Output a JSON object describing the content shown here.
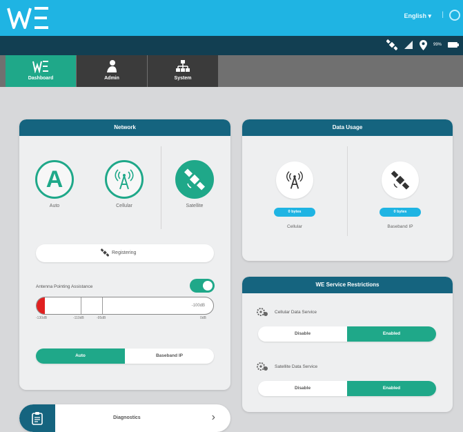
{
  "header": {
    "language": "English",
    "language_caret": "▾",
    "separator": "|"
  },
  "status": {
    "icons": [
      "satellite-icon",
      "signal-icon",
      "location-icon",
      "battery-icon"
    ],
    "battery_percent": "99%"
  },
  "nav": {
    "tabs": [
      {
        "label": "Dashboard",
        "icon": "we-logo-icon",
        "active": true
      },
      {
        "label": "Admin",
        "icon": "user-icon",
        "active": false
      },
      {
        "label": "System",
        "icon": "network-tree-icon",
        "active": false
      }
    ]
  },
  "network": {
    "title": "Network",
    "modes": [
      {
        "label": "Auto",
        "icon": "letter-a-icon",
        "glyph": "A"
      },
      {
        "label": "Cellular",
        "icon": "cell-tower-icon"
      },
      {
        "label": "Satellite",
        "icon": "satellite-icon",
        "selected": true
      }
    ],
    "registration_status": "Registering",
    "antenna_label": "Antenna Pointing Assistance",
    "antenna_enabled": true,
    "signal_value": "-100dB",
    "signal_ticks": [
      "-130dB",
      "-110dB",
      "-95dB",
      "0dB"
    ],
    "route_options": [
      "Auto",
      "Baseband IP"
    ],
    "route_selected": "Auto"
  },
  "data_usage": {
    "title": "Data Usage",
    "items": [
      {
        "label": "Cellular",
        "value": "0 bytes",
        "icon": "cell-tower-icon"
      },
      {
        "label": "Baseband IP",
        "value": "0 bytes",
        "icon": "satellite-icon"
      }
    ]
  },
  "restrictions": {
    "title": "WE Service Restrictions",
    "services": [
      {
        "label": "Cellular Data Service",
        "options": [
          "Disable",
          "Enabled"
        ],
        "selected": "Enabled"
      },
      {
        "label": "Satellite Data Service",
        "options": [
          "Disable",
          "Enabled"
        ],
        "selected": "Enabled"
      }
    ]
  },
  "diagnostics": {
    "label": "Diagnostics",
    "chevron": "›"
  },
  "colors": {
    "header_blue": "#1fb4e3",
    "dark_teal": "#15647f",
    "accent_green": "#1fa889",
    "status_dark": "#123f52",
    "alert_red": "#e02020"
  }
}
